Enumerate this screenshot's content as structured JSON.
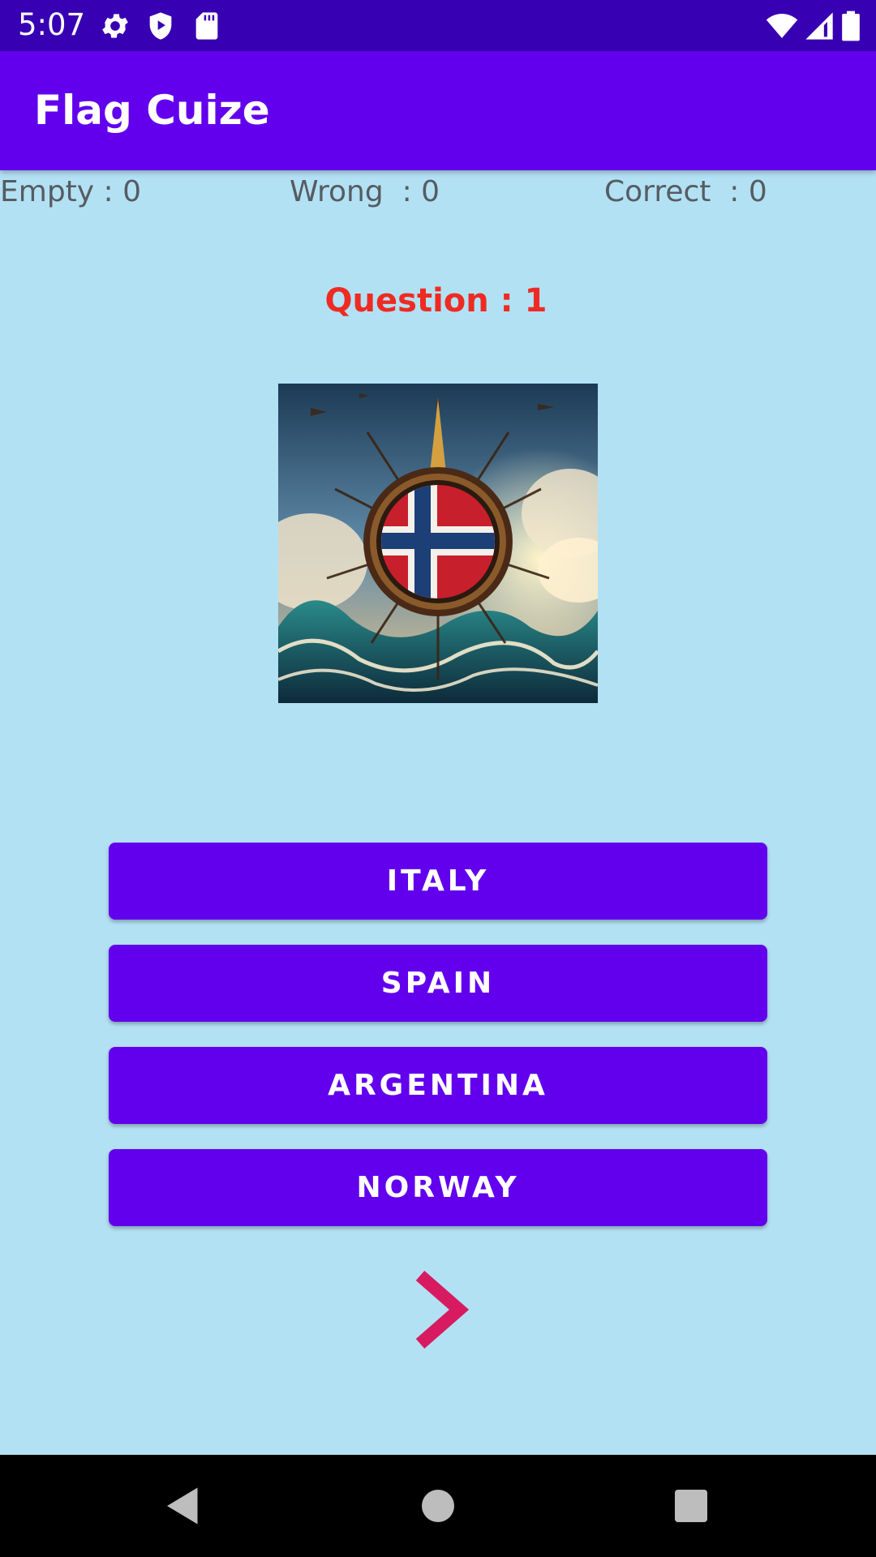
{
  "status_bar": {
    "time": "5:07",
    "icons": [
      "gear-icon",
      "shield-play-icon",
      "sd-card-icon",
      "wifi-icon",
      "cellular-signal-icon",
      "battery-icon"
    ]
  },
  "app_bar": {
    "title": "Flag Cuize"
  },
  "scores": {
    "empty": "Empty : 0",
    "wrong": "Wrong  : 0",
    "correct": "Correct  : 0"
  },
  "question": {
    "label": "Question : 1"
  },
  "flag_image": {
    "description_icon": "norway-flag-artwork"
  },
  "answers": [
    {
      "label": "ITALY"
    },
    {
      "label": "SPAIN"
    },
    {
      "label": "ARGENTINA"
    },
    {
      "label": "NORWAY"
    }
  ],
  "next_button": {
    "icon": "chevron-right-icon"
  },
  "nav_bar": {
    "icons": [
      "back-icon",
      "home-icon",
      "recents-icon"
    ]
  },
  "colors": {
    "status_bar": "#3700b3",
    "app_bar": "#6200ee",
    "background": "#b3e1f4",
    "button": "#6200ee",
    "question_text": "#ee2b22",
    "next_chevron": "#d81b60"
  }
}
